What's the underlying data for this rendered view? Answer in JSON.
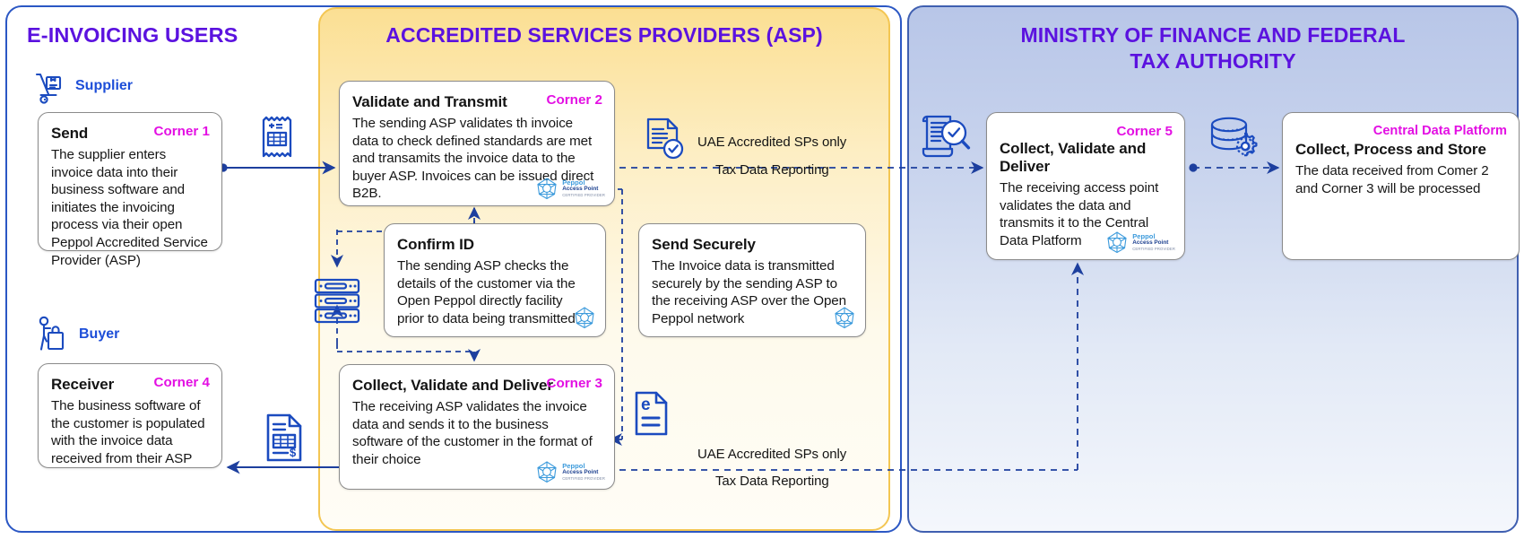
{
  "panels": {
    "users": {
      "title": "E-INVOICING USERS"
    },
    "asp": {
      "title": "ACCREDITED SERVICES PROVIDERS (ASP)"
    },
    "ministry": {
      "title": "MINISTRY OF FINANCE AND FEDERAL\nTAX AUTHORITY",
      "line1": "MINISTRY OF FINANCE AND FEDERAL",
      "line2": "TAX AUTHORITY"
    }
  },
  "roles": {
    "supplier": "Supplier",
    "buyer": "Buyer"
  },
  "cards": {
    "send": {
      "title": "Send",
      "tag": "Corner 1",
      "body": "The supplier enters invoice data into their business software and initiates the invoicing process via their open Peppol Accredited Service Provider (ASP)"
    },
    "receiver": {
      "title": "Receiver",
      "tag": "Corner 4",
      "body": "The business software of the customer is populated with the invoice data received from their ASP"
    },
    "validate_transmit": {
      "title": "Validate and Transmit",
      "tag": "Corner 2",
      "body": "The sending ASP validates th invoice data to check defined standards are met and transamits the invoice data to the buyer ASP. Invoices can be issued direct B2B."
    },
    "confirm_id": {
      "title": "Confirm ID",
      "tag": "",
      "body": "The sending ASP checks the details of the customer via the Open Peppol directly facility prior to data being transmitted"
    },
    "send_securely": {
      "title": "Send Securely",
      "tag": "",
      "body": "The Invoice data is transmitted securely by the sending ASP to the receiving ASP over the Open Peppol network"
    },
    "collect_deliver_asp": {
      "title": "Collect, Validate and Deliver",
      "tag": "Corner 3",
      "body": "The receiving ASP validates the invoice data and sends it to the business software of the customer in the format of their choice"
    },
    "corner5": {
      "title": "Collect, Validate and Deliver",
      "tag": "Corner 5",
      "body": "The receiving access point validates the data and transmits it to the Central Data Platform"
    },
    "central_data_platform": {
      "title": "Collect, Process and Store",
      "tag": "Central Data Platform",
      "body": "The data received from Comer 2 and Corner 3 will be processed"
    }
  },
  "peppol_logo": {
    "line1": "Peppol",
    "line2": "Access Point",
    "line3": "CERTIFIED PROVIDER"
  },
  "flow_labels": {
    "top_uae": "UAE Accredited SPs only",
    "top_tax": "Tax Data Reporting",
    "bottom_uae": "UAE Accredited SPs only",
    "bottom_tax": "Tax Data Reporting"
  },
  "icons": {
    "supplier": "hand-truck-icon",
    "buyer": "shopper-icon",
    "invoice_receipt": "receipt-dollar-icon",
    "document_check": "document-check-icon",
    "server_rack": "server-rack-icon",
    "e_invoice": "e-invoice-document-icon",
    "invoice_doc": "invoice-document-icon",
    "audit_magnifier": "scroll-magnifier-icon",
    "database_gear": "database-gear-icon"
  },
  "colors": {
    "panel_title": "#5b12df",
    "corner_tag": "#e30fe3",
    "role_label": "#1d4ed8",
    "arrow_solid": "#1d3f9e",
    "arrow_dashed": "#1d3f9e",
    "panel_users_border": "#2b57c4",
    "panel_asp_border": "#f3c653",
    "panel_mof_border": "#3f5fb0",
    "icon_blue": "#1b4bbf"
  }
}
